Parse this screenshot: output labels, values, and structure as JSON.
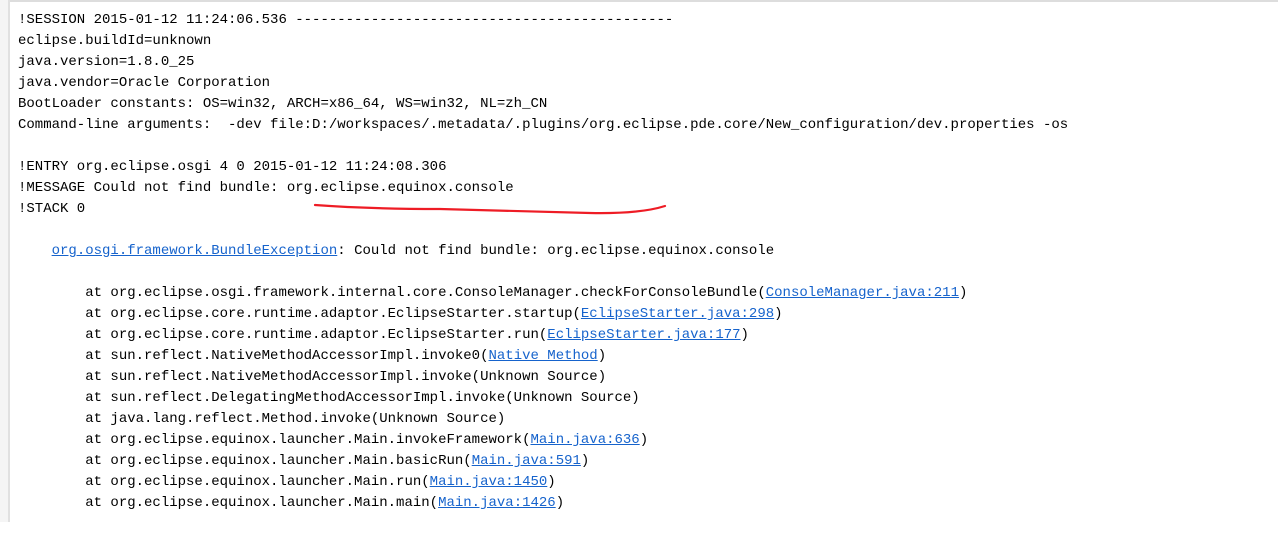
{
  "session": {
    "session_line": "!SESSION 2015-01-12 11:24:06.536 ---------------------------------------------",
    "build_id": "eclipse.buildId=unknown",
    "java_version": "java.version=1.8.0_25",
    "java_vendor": "java.vendor=Oracle Corporation",
    "bootloader": "BootLoader constants: OS=win32, ARCH=x86_64, WS=win32, NL=zh_CN",
    "cmd_args": "Command-line arguments:  -dev file:D:/workspaces/.metadata/.plugins/org.eclipse.pde.core/New_configuration/dev.properties -os"
  },
  "entry": {
    "entry_line": "!ENTRY org.eclipse.osgi 4 0 2015-01-12 11:24:08.306",
    "message_line": "!MESSAGE Could not find bundle: org.eclipse.equinox.console",
    "stack_line": "!STACK 0"
  },
  "exception": {
    "class_link": "org.osgi.framework.BundleException",
    "message": ": Could not find bundle: org.eclipse.equinox.console"
  },
  "stack": [
    {
      "prefix": "        at org.eclipse.osgi.framework.internal.core.ConsoleManager.checkForConsoleBundle(",
      "link": "ConsoleManager.java:211",
      "suffix": ")"
    },
    {
      "prefix": "        at org.eclipse.core.runtime.adaptor.EclipseStarter.startup(",
      "link": "EclipseStarter.java:298",
      "suffix": ")"
    },
    {
      "prefix": "        at org.eclipse.core.runtime.adaptor.EclipseStarter.run(",
      "link": "EclipseStarter.java:177",
      "suffix": ")"
    },
    {
      "prefix": "        at sun.reflect.NativeMethodAccessorImpl.invoke0(",
      "link": "Native Method",
      "suffix": ")"
    },
    {
      "prefix": "        at sun.reflect.NativeMethodAccessorImpl.invoke(Unknown Source)",
      "link": "",
      "suffix": ""
    },
    {
      "prefix": "        at sun.reflect.DelegatingMethodAccessorImpl.invoke(Unknown Source)",
      "link": "",
      "suffix": ""
    },
    {
      "prefix": "        at java.lang.reflect.Method.invoke(Unknown Source)",
      "link": "",
      "suffix": ""
    },
    {
      "prefix": "        at org.eclipse.equinox.launcher.Main.invokeFramework(",
      "link": "Main.java:636",
      "suffix": ")"
    },
    {
      "prefix": "        at org.eclipse.equinox.launcher.Main.basicRun(",
      "link": "Main.java:591",
      "suffix": ")"
    },
    {
      "prefix": "        at org.eclipse.equinox.launcher.Main.run(",
      "link": "Main.java:1450",
      "suffix": ")"
    },
    {
      "prefix": "        at org.eclipse.equinox.launcher.Main.main(",
      "link": "Main.java:1426",
      "suffix": ")"
    }
  ],
  "annotation": {
    "stroke": "#ee1c25"
  }
}
